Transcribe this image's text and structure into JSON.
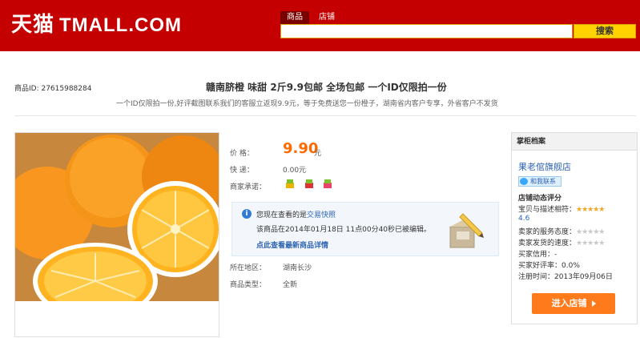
{
  "header": {
    "logo_cn": "天猫",
    "logo_en": "TMALL.COM",
    "tabs": [
      "商品",
      "店铺"
    ],
    "search_placeholder": "",
    "search_button": "搜索",
    "brand_color": "#c40000"
  },
  "product": {
    "id_text": "商品ID: 27615988284",
    "title": "赣南脐橙 味甜 2斤9.9包邮 全场包邮 一个ID仅限拍一份",
    "subtitle": "一个ID仅限拍一份,好评截图联系我们的客服立返现9.9元，等于免费送您一份橙子，湖南省内客户专享，外省客户不发货",
    "price_label": "价    格：",
    "price_value": "9.90",
    "price_unit": "元",
    "shipping_label": "快    递：",
    "shipping_value": "0.00元",
    "promise_label": "商家承诺：",
    "promise_icons": [
      "promise-icon-1",
      "promise-icon-2",
      "promise-icon-3"
    ],
    "notice": {
      "line1_prefix": "您现在查看的是",
      "line1_link": "交易快照",
      "line2": "该商品在2014年01月18日 11点00分40秒已被编辑。",
      "line3": "点此查看最新商品详情"
    },
    "region_label": "所在地区：",
    "region_value": "湖南长沙",
    "type_label": "商品类型：",
    "type_value": "全新"
  },
  "sidebar": {
    "heading": "掌柜档案",
    "shop_name": "果老倌旗舰店",
    "contact_label": "和我联系",
    "dynamic_title": "店铺动态评分",
    "desc_match_label": "宝贝与描述相符：",
    "desc_match_score": "4.6",
    "service_label": "卖家的服务态度：",
    "delivery_label": "卖家发货的速度：",
    "credit_label": "买家信用：",
    "credit_value": "-",
    "good_rate_label": "买家好评率：",
    "good_rate_value": "0.0%",
    "register_label": "注册时间：",
    "register_value": "2013年09月06日",
    "enter_shop": "进入店铺"
  }
}
